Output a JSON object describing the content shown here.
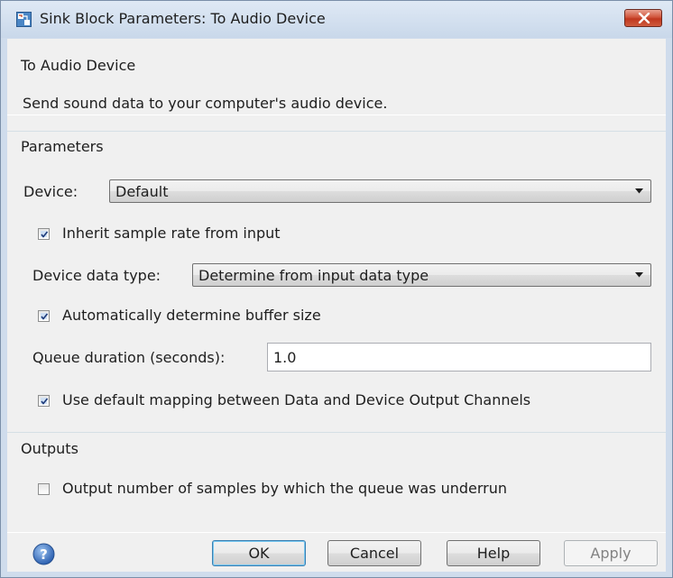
{
  "window": {
    "title": "Sink Block Parameters: To Audio Device"
  },
  "description": {
    "group_title": "To Audio Device",
    "text": "Send sound data to your computer's audio device."
  },
  "parameters": {
    "group_title": "Parameters",
    "device_label": "Device:",
    "device_value": "Default",
    "inherit_sample_rate_label": "Inherit sample rate from input",
    "inherit_sample_rate_checked": true,
    "device_data_type_label": "Device data type:",
    "device_data_type_value": "Determine from input data type",
    "auto_buffer_label": "Automatically determine buffer size",
    "auto_buffer_checked": true,
    "queue_duration_label": "Queue duration (seconds):",
    "queue_duration_value": "1.0",
    "default_mapping_label": "Use default mapping between Data and Device Output Channels",
    "default_mapping_checked": true
  },
  "outputs": {
    "group_title": "Outputs",
    "underrun_label": "Output number of samples by which the queue was underrun",
    "underrun_checked": false
  },
  "buttons": {
    "ok": "OK",
    "cancel": "Cancel",
    "help": "Help",
    "apply": "Apply"
  },
  "icons": {
    "app": "simulink-block-icon",
    "close": "close-icon",
    "help": "help-icon",
    "dropdown": "chevron-down-icon",
    "check": "check-icon"
  },
  "colors": {
    "titlebar": "#dfe9f5",
    "close_button": "#c9442a",
    "panel": "#f0f0f0",
    "default_button_border": "#3c7fb1"
  }
}
